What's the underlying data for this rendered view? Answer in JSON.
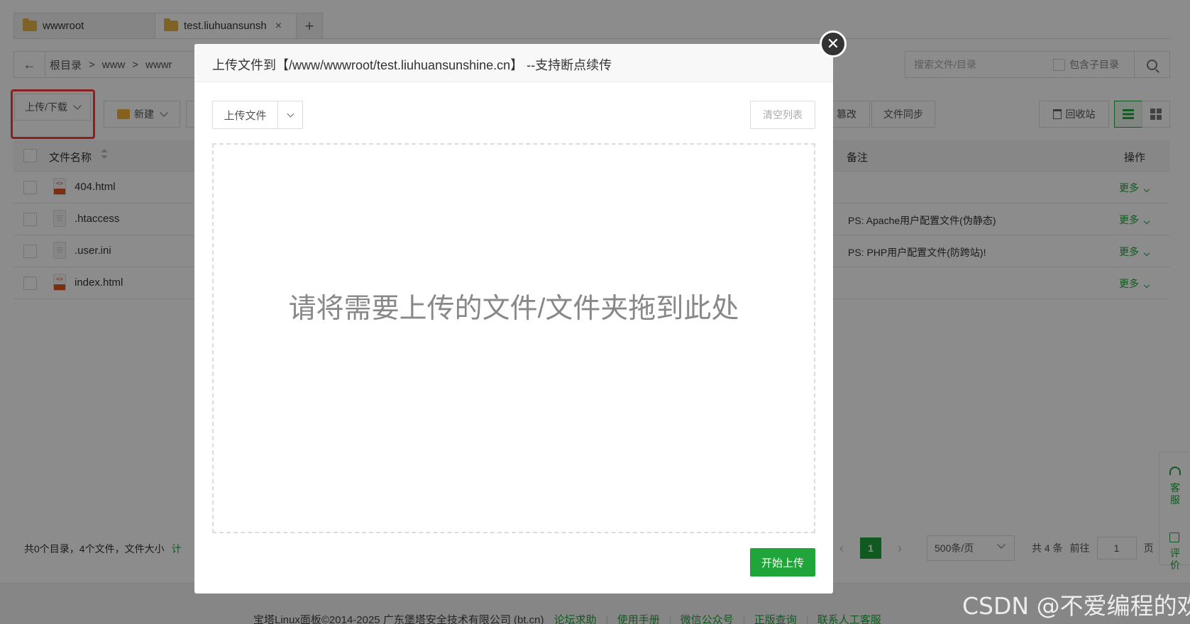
{
  "tabs": [
    {
      "label": "wwwroot"
    },
    {
      "label": "test.liuhuansunsh"
    }
  ],
  "tab_add": "+",
  "tab_close": "×",
  "path": {
    "back": "←",
    "crumbs": [
      "根目录",
      "www",
      "wwwr"
    ],
    "sep": ">"
  },
  "search": {
    "placeholder": "搜索文件/目录",
    "include_sub": "包含子目录"
  },
  "toolbar": {
    "upload_download": "上传/下载",
    "new": "新建",
    "tamper": "篡改",
    "file_sync": "文件同步",
    "recycle": "回收站"
  },
  "table": {
    "headers": {
      "name": "文件名称",
      "note": "备注",
      "action": "操作"
    },
    "rows": [
      {
        "name": "404.html",
        "note": "",
        "more": "更多"
      },
      {
        "name": ".htaccess",
        "note": "PS: Apache用户配置文件(伪静态)",
        "more": "更多"
      },
      {
        "name": ".user.ini",
        "note": "PS: PHP用户配置文件(防跨站)!",
        "more": "更多"
      },
      {
        "name": "index.html",
        "note": "",
        "more": "更多"
      }
    ]
  },
  "footer": {
    "stats": "共0个目录，4个文件，文件大小",
    "calc": "计",
    "page_current": "1",
    "page_size": "500条/页",
    "total": "共 4 条",
    "goto": "前往",
    "goto_value": "1",
    "page_unit": "页"
  },
  "copyright": {
    "text": "宝塔Linux面板©2014-2025 广东堡塔安全技术有限公司 (bt.cn)",
    "links": [
      "论坛求助",
      "使用手册",
      "微信公众号",
      "正版查询",
      "联系人工客服"
    ]
  },
  "sidewidget": {
    "service": "客服",
    "review": "评价"
  },
  "modal": {
    "title": "上传文件到【/www/wwwroot/test.liuhuansunshine.cn】 --支持断点续传",
    "close": "✕",
    "upload_file": "上传文件",
    "clear_list": "清空列表",
    "drop_hint": "请将需要上传的文件/文件夹拖到此处",
    "start_upload": "开始上传"
  },
  "watermark": "CSDN @不爱编程的欢",
  "colors": {
    "accent": "#20a53a",
    "highlight": "#ff3b3b",
    "folder": "#e8b445"
  }
}
